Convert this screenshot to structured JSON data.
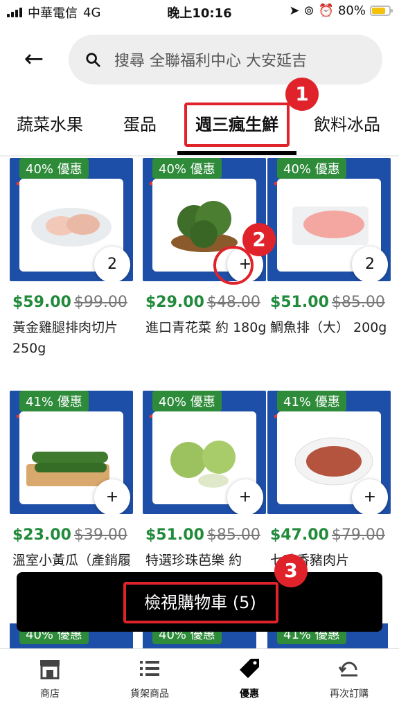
{
  "status": {
    "carrier": "中華電信",
    "network": "4G",
    "time": "晚上10:16",
    "battery": "80%"
  },
  "search": {
    "placeholder": "搜尋 全聯福利中心 大安延吉"
  },
  "tabs": [
    "蔬菜水果",
    "蛋品",
    "週三瘋生鮮",
    "飲料冰品"
  ],
  "active_tab": "週三瘋生鮮",
  "annotations": [
    "1",
    "2",
    "3"
  ],
  "products": [
    {
      "discount": "40% 優惠",
      "price": "$59.00",
      "was": "$99.00",
      "name": "黃金雞腿排肉切片 250g",
      "qty": "2"
    },
    {
      "discount": "40% 優惠",
      "price": "$29.00",
      "was": "$48.00",
      "name": "進口青花菜 約 180g",
      "qty": "+"
    },
    {
      "discount": "40% 優惠",
      "price": "$51.00",
      "was": "$85.00",
      "name": "鯛魚排（大） 200g",
      "qty": "2"
    },
    {
      "discount": "41% 優惠",
      "price": "$23.00",
      "was": "$39.00",
      "name": "溫室小黃瓜（產銷履",
      "qty": "+"
    },
    {
      "discount": "40% 優惠",
      "price": "$51.00",
      "was": "$85.00",
      "name": "特選珍珠芭樂 約",
      "qty": "+"
    },
    {
      "discount": "41% 優惠",
      "price": "$47.00",
      "was": "$79.00",
      "name": "七味香豬肉片",
      "qty": "+"
    }
  ],
  "partial_discounts": [
    "40% 優惠",
    "40% 優惠",
    "41% 優惠"
  ],
  "cart": {
    "label": "檢視購物車 (5)"
  },
  "nav": [
    {
      "label": "商店",
      "icon": "store-icon"
    },
    {
      "label": "貨架商品",
      "icon": "list-icon"
    },
    {
      "label": "優惠",
      "icon": "tag-icon"
    },
    {
      "label": "再次訂購",
      "icon": "reorder-icon"
    }
  ],
  "colors": {
    "accent": "#e0232a",
    "price": "#218a3b",
    "promo_bg": "#1e4fa8",
    "badge": "#2e8b3a"
  }
}
